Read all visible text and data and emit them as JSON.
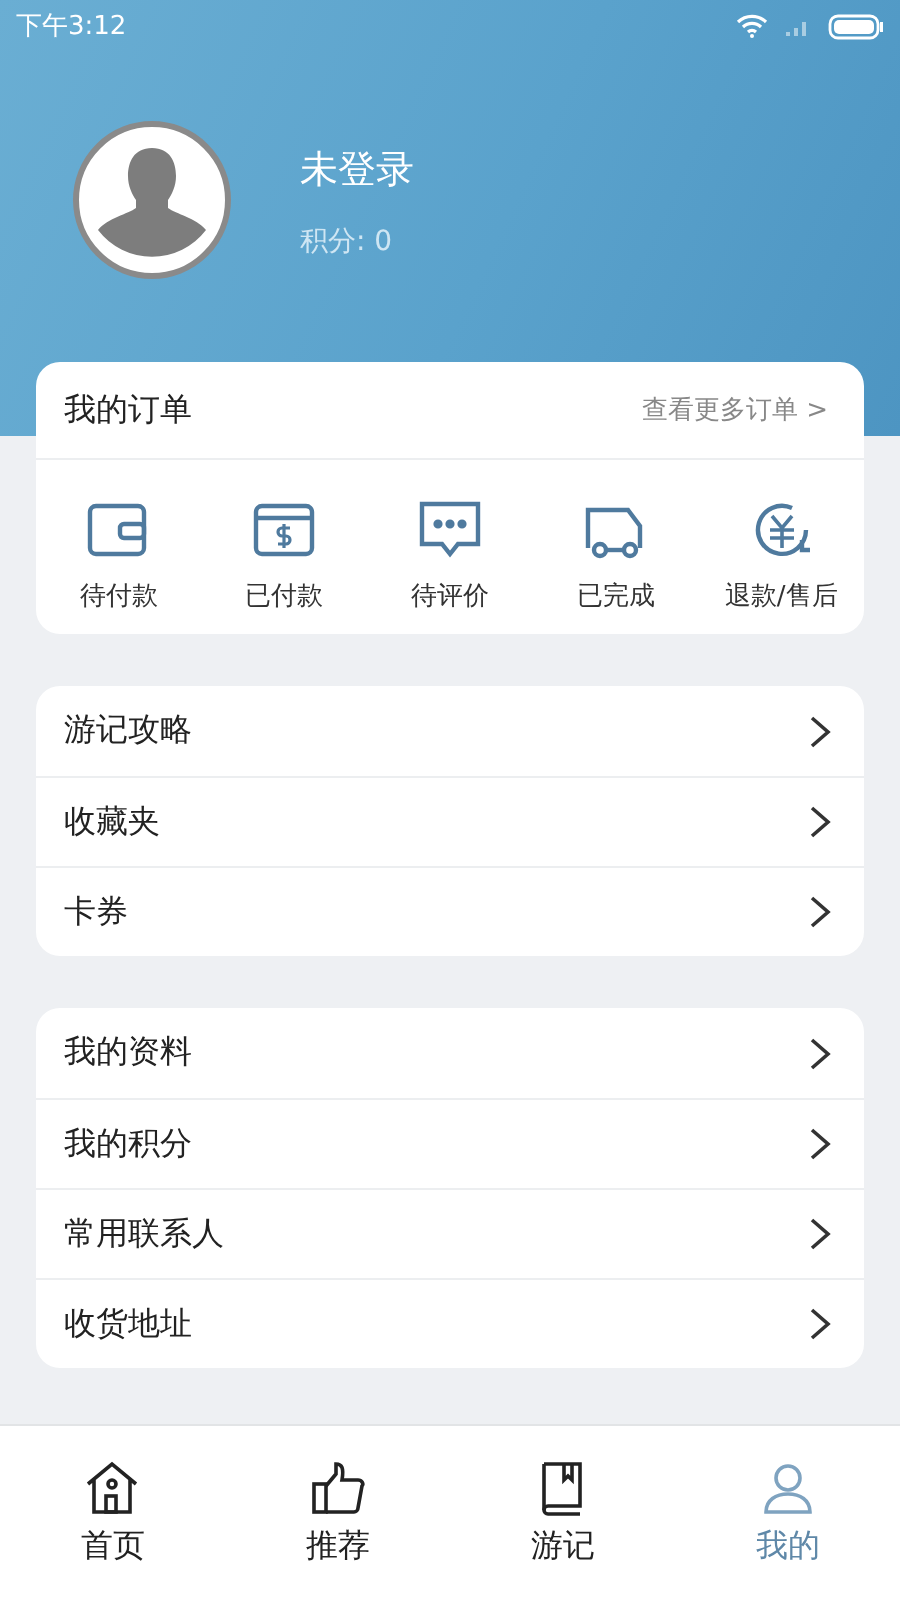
{
  "status_bar": {
    "time": "下午3:12"
  },
  "profile": {
    "name": "未登录",
    "points": "积分: 0"
  },
  "orders": {
    "title": "我的订单",
    "more": "查看更多订单 >",
    "items": [
      {
        "kind": "wallet",
        "label": "待付款"
      },
      {
        "kind": "paid",
        "label": "已付款"
      },
      {
        "kind": "comment",
        "label": "待评价"
      },
      {
        "kind": "truck",
        "label": "已完成"
      },
      {
        "kind": "refund",
        "label": "退款/售后"
      }
    ]
  },
  "menu_groups": [
    {
      "items": [
        {
          "label": "游记攻略"
        },
        {
          "label": "收藏夹"
        },
        {
          "label": "卡券"
        }
      ]
    },
    {
      "items": [
        {
          "label": "我的资料"
        },
        {
          "label": "我的积分"
        },
        {
          "label": "常用联系人"
        },
        {
          "label": "收货地址"
        }
      ]
    }
  ],
  "tab_bar": [
    {
      "kind": "home",
      "label": "首页",
      "selected": false
    },
    {
      "kind": "thumb",
      "label": "推荐",
      "selected": false
    },
    {
      "kind": "book",
      "label": "游记",
      "selected": false
    },
    {
      "kind": "user",
      "label": "我的",
      "selected": true
    }
  ]
}
